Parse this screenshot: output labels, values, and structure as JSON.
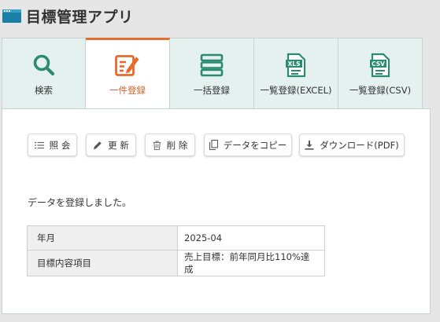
{
  "app": {
    "title": "目標管理アプリ"
  },
  "tabs": [
    {
      "label": "検索",
      "icon": "search-icon"
    },
    {
      "label": "一件登録",
      "icon": "edit-icon",
      "active": true
    },
    {
      "label": "一括登録",
      "icon": "list-icon"
    },
    {
      "label": "一覧登録(EXCEL)",
      "icon": "xls-file-icon",
      "badge": "XLS"
    },
    {
      "label": "一覧登録(CSV)",
      "icon": "csv-file-icon",
      "badge": "CSV"
    }
  ],
  "toolbar": {
    "inquiry": "照 会",
    "update": "更 新",
    "delete": "削 除",
    "copy": "データをコピー",
    "download": "ダウンロード(PDF)"
  },
  "message": "データを登録しました。",
  "record": [
    {
      "label": "年月",
      "value": "2025-04"
    },
    {
      "label": "目標内容項目",
      "value": "売上目標：前年同月比110%達成"
    }
  ],
  "colors": {
    "accent": "#e56b2c",
    "icon": "#2a8a72",
    "tab_bg": "#e5f1ee"
  }
}
